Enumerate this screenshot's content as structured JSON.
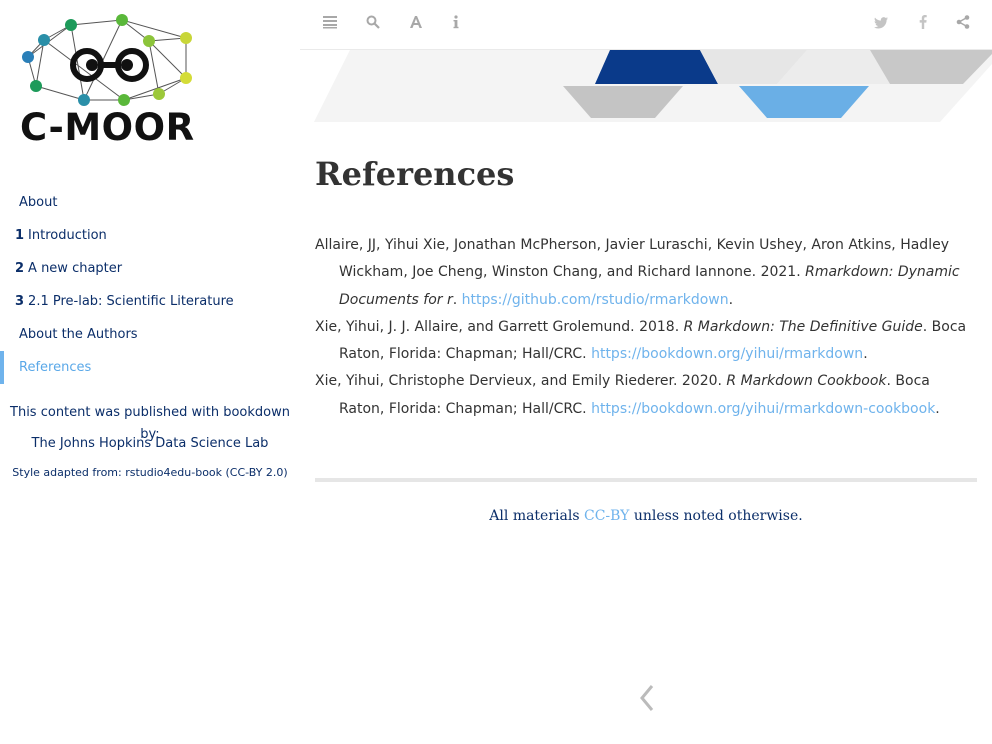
{
  "logo": {
    "text": "C-MOOR"
  },
  "sidebar": {
    "items": [
      {
        "num": "",
        "label": "About"
      },
      {
        "num": "1",
        "label": "Introduction"
      },
      {
        "num": "2",
        "label": "A new chapter"
      },
      {
        "num": "3",
        "label": "2.1 Pre-lab: Scientific Literature"
      },
      {
        "num": "",
        "label": "About the Authors"
      },
      {
        "num": "",
        "label": "References"
      }
    ],
    "credits": {
      "line1": "This content was published with bookdown by:",
      "line2": "The Johns Hopkins Data Science Lab",
      "line3": "Style adapted from: rstudio4edu-book (CC-BY 2.0)"
    }
  },
  "toolbar": {
    "left_icons": [
      "toc-toggle-icon",
      "search-icon",
      "font-settings-icon",
      "info-icon"
    ],
    "right_icons": [
      "twitter-icon",
      "facebook-icon",
      "share-icon"
    ]
  },
  "main": {
    "title": "References",
    "refs": [
      {
        "authors": "Allaire, JJ, Yihui Xie, Jonathan McPherson, Javier Luraschi, Kevin Ushey, Aron Atkins, Hadley Wickham, Joe Cheng, Winston Chang, and Richard Iannone. 2021. ",
        "title": "Rmarkdown: Dynamic Documents for r",
        "post": ". ",
        "url": "https://github.com/rstudio/rmarkdown",
        "end": "."
      },
      {
        "authors": "Xie, Yihui, J. J. Allaire, and Garrett Grolemund. 2018. ",
        "title": "R Markdown: The Definitive Guide",
        "post": ". Boca Raton, Florida: Chapman; Hall/CRC. ",
        "url": "https://bookdown.org/yihui/rmarkdown",
        "end": "."
      },
      {
        "authors": "Xie, Yihui, Christophe Dervieux, and Emily Riederer. 2020. ",
        "title": "R Markdown Cookbook",
        "post": ". Boca Raton, Florida: Chapman; Hall/CRC. ",
        "url": "https://bookdown.org/yihui/rmarkdown-cookbook",
        "end": "."
      }
    ]
  },
  "footer": {
    "pre": "All materials ",
    "link": "CC-BY",
    "post": " unless noted otherwise."
  },
  "colors": {
    "nav_text": "#0b2e69",
    "active": "#6fb3ec",
    "link": "#6fb3ec",
    "banner_dark": "#0a3a8a",
    "banner_light_blue": "#6aafe6",
    "banner_gray": "#c8c8c8"
  }
}
